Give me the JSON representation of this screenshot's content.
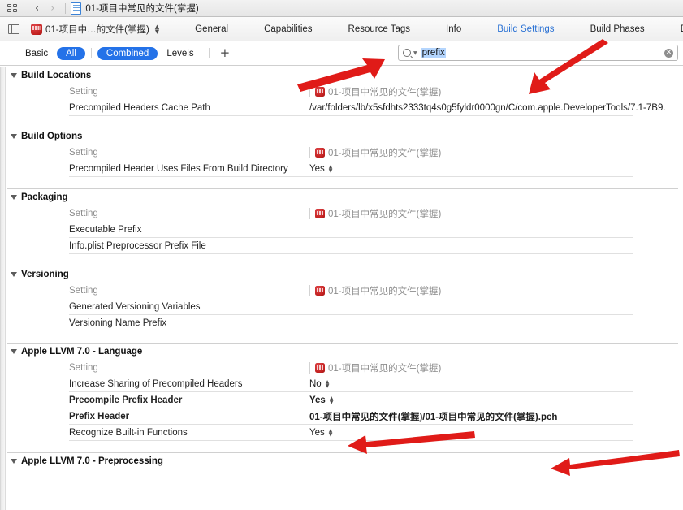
{
  "window": {
    "navbar": {
      "related_items_icon": "grid-icon",
      "back_label": "‹",
      "forward_label": "›",
      "doc_icon": "document-icon",
      "title": "01-项目中常见的文件(掌握)"
    },
    "tabbar": {
      "panel_toggle_icon": "navigator-toggle-icon",
      "project_icon": "xcode-project-icon",
      "project_name": "01-项目中…的文件(掌握)",
      "stepper_up": "▲",
      "stepper_down": "▼",
      "tabs": [
        {
          "label": "General",
          "active": false
        },
        {
          "label": "Capabilities",
          "active": false
        },
        {
          "label": "Resource Tags",
          "active": false
        },
        {
          "label": "Info",
          "active": false
        },
        {
          "label": "Build Settings",
          "active": true
        },
        {
          "label": "Build Phases",
          "active": false
        },
        {
          "label": "Build R",
          "active": false
        }
      ]
    },
    "filterbar": {
      "segments": [
        {
          "label": "Basic",
          "selected": false
        },
        {
          "label": "All",
          "selected": true
        },
        {
          "label": "Combined",
          "selected": true
        },
        {
          "label": "Levels",
          "selected": false
        }
      ],
      "add_label": "+",
      "search": {
        "icon": "search-icon",
        "dropdown_caret": "▼",
        "value": "prefix",
        "placeholder": "",
        "clear_label": "✕"
      }
    }
  },
  "table": {
    "column_header_label": "Setting",
    "target_name": "01-项目中常见的文件(掌握)",
    "sections": [
      {
        "title": "Build Locations",
        "rows": [
          {
            "name": "Precompiled Headers Cache Path",
            "value": "/var/folders/lb/x5sfdhts2333tq4s0g5fyldr0000gn/C/com.apple.DeveloperTools/7.1-7B9.",
            "bold": false,
            "stepper": false
          }
        ]
      },
      {
        "title": "Build Options",
        "rows": [
          {
            "name": "Precompiled Header Uses Files From Build Directory",
            "value": "Yes",
            "bold": false,
            "stepper": true
          }
        ]
      },
      {
        "title": "Packaging",
        "rows": [
          {
            "name": "Executable Prefix",
            "value": "",
            "bold": false,
            "stepper": false
          },
          {
            "name": "Info.plist Preprocessor Prefix File",
            "value": "",
            "bold": false,
            "stepper": false
          }
        ]
      },
      {
        "title": "Versioning",
        "rows": [
          {
            "name": "Generated Versioning Variables",
            "value": "",
            "bold": false,
            "stepper": false
          },
          {
            "name": "Versioning Name Prefix",
            "value": "",
            "bold": false,
            "stepper": false
          }
        ]
      },
      {
        "title": "Apple LLVM 7.0 - Language",
        "rows": [
          {
            "name": "Increase Sharing of Precompiled Headers",
            "value": "No",
            "bold": false,
            "stepper": true
          },
          {
            "name": "Precompile Prefix Header",
            "value": "Yes",
            "bold": true,
            "stepper": true
          },
          {
            "name": "Prefix Header",
            "value": "01-项目中常见的文件(掌握)/01-项目中常见的文件(掌握).pch",
            "bold": true,
            "stepper": false
          },
          {
            "name": "Recognize Built-in Functions",
            "value": "Yes",
            "bold": false,
            "stepper": true
          }
        ]
      },
      {
        "title": "Apple LLVM 7.0 - Preprocessing",
        "rows": []
      }
    ]
  },
  "annotations": {
    "color": "#e01b18",
    "arrows": [
      {
        "name": "arrow-to-search-field"
      },
      {
        "name": "arrow-to-build-settings-tab"
      },
      {
        "name": "arrow-to-precompile-prefix-header"
      },
      {
        "name": "arrow-to-prefix-header"
      }
    ]
  }
}
